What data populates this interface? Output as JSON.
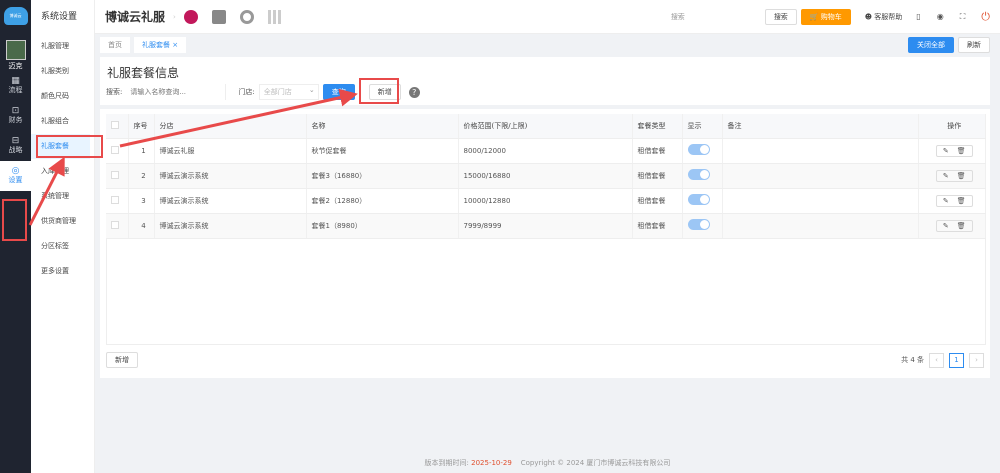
{
  "rail": {
    "user": "迈克",
    "items": [
      {
        "icon": "grid-icon",
        "label": "流程"
      },
      {
        "icon": "finance-icon",
        "label": "财务"
      },
      {
        "icon": "strategy-icon",
        "label": "战略"
      },
      {
        "icon": "gear-icon",
        "label": "设置"
      }
    ]
  },
  "submenu": {
    "title": "系统设置",
    "items": [
      "礼服管理",
      "礼服类别",
      "颜色尺码",
      "礼服组合",
      "礼服套餐",
      "入库管理",
      "系统管理",
      "供货商管理",
      "分区标签",
      "更多设置"
    ],
    "active": 4
  },
  "topbar": {
    "brand": "博诚云礼服",
    "search_placeholder": "搜索",
    "search_btn": "搜索",
    "cart": "购物车",
    "help": "客服帮助"
  },
  "tabs": {
    "items": [
      "首页",
      "礼服套餐"
    ],
    "close_all": "关闭全部",
    "refresh": "刷新"
  },
  "page": {
    "title": "礼服套餐信息",
    "search_label": "搜索:",
    "search_placeholder": "请输入名称查询...",
    "store_label": "门店:",
    "store_value": "全部门店",
    "query": "查询",
    "add": "新增"
  },
  "table": {
    "headers": [
      "序号",
      "分店",
      "名称",
      "价格范围(下限/上限)",
      "套餐类型",
      "显示",
      "备注",
      "操作"
    ],
    "rows": [
      {
        "no": "1",
        "store": "博诚云礼服",
        "name": "秋节促套餐",
        "price": "8000/12000",
        "type": "租借套餐",
        "show": true,
        "note": ""
      },
      {
        "no": "2",
        "store": "博诚云演示系统",
        "name": "套餐3（16880）",
        "price": "15000/16880",
        "type": "租借套餐",
        "show": true,
        "note": ""
      },
      {
        "no": "3",
        "store": "博诚云演示系统",
        "name": "套餐2（12880）",
        "price": "10000/12880",
        "type": "租借套餐",
        "show": true,
        "note": ""
      },
      {
        "no": "4",
        "store": "博诚云演示系统",
        "name": "套餐1（8980）",
        "price": "7999/8999",
        "type": "租借套餐",
        "show": true,
        "note": ""
      }
    ]
  },
  "footer_bar": {
    "add": "新增",
    "total": "共 4 条",
    "page": "1"
  },
  "footer": {
    "label": "版本到期时间:",
    "date": "2025-10-29",
    "copyright": "Copyright © 2024 厦门市博诚云科技有限公司"
  },
  "colors": {
    "accent": "#2d8cf0",
    "cart": "#ff9900",
    "annotation": "#e84a4a"
  }
}
